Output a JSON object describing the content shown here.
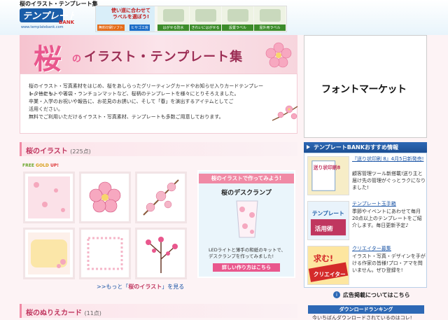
{
  "header": {
    "site_title": "桜のイラスト・テンプレート集",
    "logo_text": "テンプレートBANK",
    "logo_url": "www.templatebank.com",
    "banner": {
      "line1": "使い道に合わせて",
      "line2": "ラベルを選ぼう!",
      "tag1": "無料印刷ソフト",
      "tag2": "ヒサゴ工房",
      "thumbs": [
        "はがせる防水",
        "きれいにはがせる",
        "設置ラベル",
        "屋外用ラベル"
      ]
    }
  },
  "hero": {
    "sakura": "桜",
    "no": "の",
    "title": "イラスト・テンプレート集"
  },
  "intro": {
    "lines": [
      "桜のイラスト・写真素材をはじめ、桜をあしらったグリーティングカードやお知らせ入りカードテンプレート、他にも、",
      "レターセットや箸袋・ランチョンマットなど、桜柄のテンプレートを様々にとりそろえました。",
      "卒業・入学のお祝いや報告に、お花見のお誘いに、そして「春」を演出するアイテムとしてご",
      "活用ください。",
      "無料でご利用いただけるイラスト・写真素材、テンプレートも多数ご用意しております。"
    ]
  },
  "ad": {
    "logo": "フォントマーケット"
  },
  "section_illust": {
    "title": "桜のイラスト",
    "count": "(225点)"
  },
  "gold_tag": {
    "free": "FREE",
    "gold": "GOLD",
    "up": "UP!"
  },
  "promo": {
    "header": "桜のイラストで作ってみよう!",
    "title": "桜のデスクランプ",
    "desc": "LEDライトと薄手の和紙のキットで、デスクランプを作ってみました!",
    "button": "詳しい作り方はこちら"
  },
  "more_link": {
    "prefix": ">>もっと「",
    "bold": "桜のイラスト",
    "suffix": "」を見る"
  },
  "section_nurie": {
    "title": "桜のぬりえカード",
    "count": "(11点)"
  },
  "recommend": {
    "header": "テンプレートBANKおすすめ情報",
    "items": [
      {
        "title": "『送り状印刷 8』4月5日新発売!",
        "desc": "顧客管理ツール新搭載!送り主と届け先の管理がぐっとラクになりました!"
      },
      {
        "title": "テンプレート玉手箱",
        "desc": "季節やイベントにあわせて毎月20点以上のテンプレートをご紹介します。毎日更新予定♪"
      },
      {
        "title": "クリエイター募集",
        "desc": "イラスト・写真・デザインを手がける作家の皆様!プロ・アマを問いません。ぜひ登録を!"
      }
    ],
    "img_labels": [
      "送り状印刷8",
      "テンプレート活用術",
      "求む!クリエイター"
    ]
  },
  "ad_note": "広告掲載についてはこちら",
  "ranking": {
    "header": "ダウンロードランキング",
    "sub": "今いちばんダウンロードされているのはコレ!"
  },
  "colors": {
    "pink": "#e9578d",
    "blue": "#2d68b5",
    "section_text": "#c0365f"
  }
}
